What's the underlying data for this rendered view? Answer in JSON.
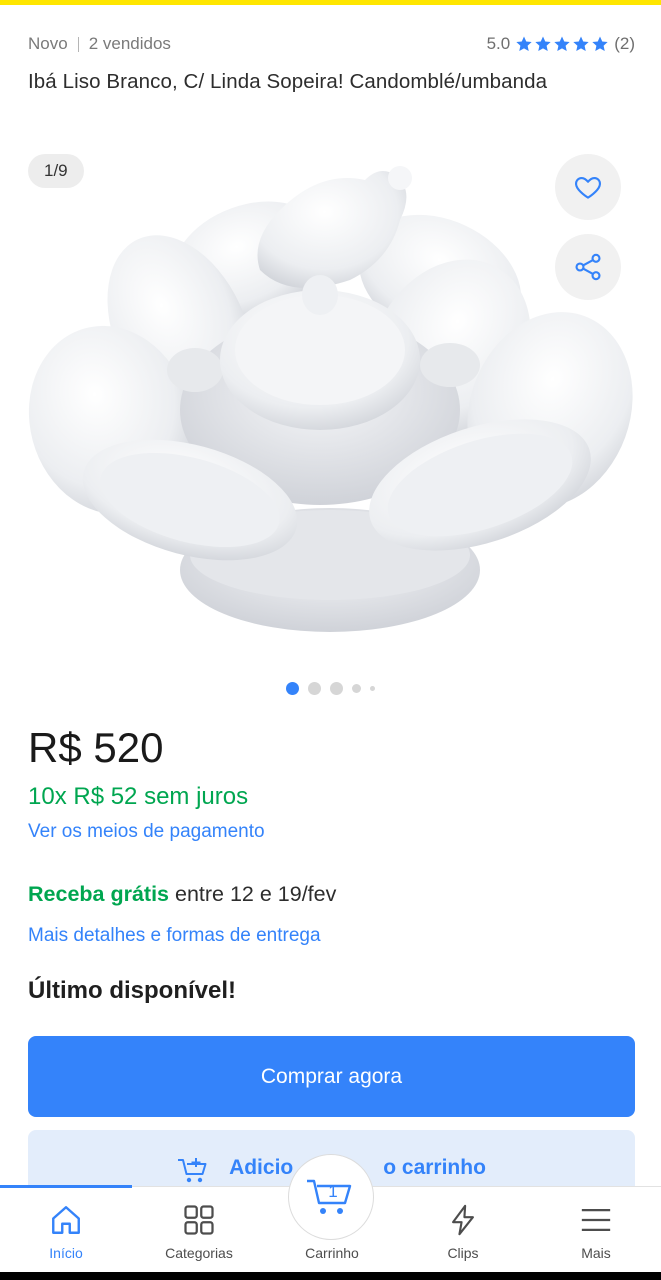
{
  "header": {
    "condition": "Novo",
    "sold": "2 vendidos",
    "rating": "5.0",
    "rating_count": "(2)",
    "stars": 5
  },
  "product": {
    "title": "Ibá Liso Branco, C/ Linda Sopeira! Candomblé/umbanda"
  },
  "gallery": {
    "counter": "1/9",
    "favorite_icon": "heart-icon",
    "share_icon": "share-icon",
    "current_index": 1,
    "visible_dots": 5
  },
  "pricing": {
    "price": "R$ 520",
    "installments": "10x R$ 52 sem juros",
    "payment_link": "Ver os meios de pagamento"
  },
  "shipping": {
    "free_label": "Receba grátis",
    "window": " entre 12 e 19/fev",
    "details_link": "Mais detalhes e formas de entrega"
  },
  "stock": "Último disponível!",
  "actions": {
    "buy_now": "Comprar agora",
    "add_to_cart_left": "Adicio",
    "add_to_cart_right": "o carrinho"
  },
  "nav": {
    "items": [
      {
        "label": "Início",
        "icon": "home-icon",
        "active": true
      },
      {
        "label": "Categorias",
        "icon": "grid-icon",
        "active": false
      },
      {
        "label": "Carrinho",
        "icon": "cart-icon",
        "active": false
      },
      {
        "label": "Clips",
        "icon": "bolt-icon",
        "active": false
      },
      {
        "label": "Mais",
        "icon": "menu-icon",
        "active": false
      }
    ],
    "cart_count": "1"
  },
  "colors": {
    "accent": "#3483fa",
    "green": "#00a650",
    "brand_yellow": "#ffe600"
  }
}
